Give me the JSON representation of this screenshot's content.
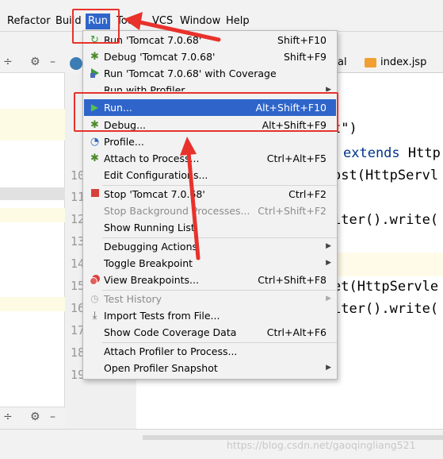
{
  "menubar": {
    "items": [
      "Refactor",
      "Build",
      "Run",
      "Tools",
      "VCS",
      "Window",
      "Help"
    ]
  },
  "editor": {
    "tabs": [
      "al",
      "index.jsp"
    ],
    "line_numbers": [
      "10",
      "11",
      "12",
      "13",
      "14",
      "15",
      "16",
      "17",
      "18",
      "19"
    ],
    "code": {
      "l1_tail": "t\")",
      "l2a": "extends",
      "l2b": " Http",
      "l3": "ost(HttpServl",
      "l4": "iter().write(",
      "l5": "et(HttpServle",
      "l6": "iter().write("
    }
  },
  "run_menu": {
    "items": [
      {
        "label": "Run 'Tomcat 7.0.68'",
        "shortcut": "Shift+F10",
        "icon": "run-config-icon"
      },
      {
        "label": "Debug 'Tomcat 7.0.68'",
        "shortcut": "Shift+F9",
        "icon": "bug-icon"
      },
      {
        "label": "Run 'Tomcat 7.0.68' with Coverage",
        "shortcut": "",
        "icon": "coverage-icon"
      },
      {
        "label": "Run with Profiler",
        "shortcut": "",
        "icon": "",
        "submenu": true
      },
      {
        "label": "Run...",
        "shortcut": "Alt+Shift+F10",
        "icon": "play-icon",
        "selected": true
      },
      {
        "label": "Debug...",
        "shortcut": "Alt+Shift+F9",
        "icon": "bug-icon"
      },
      {
        "label": "Profile...",
        "shortcut": "",
        "icon": "gauge-icon"
      },
      {
        "label": "Attach to Process...",
        "shortcut": "Ctrl+Alt+F5",
        "icon": "attach-icon"
      },
      {
        "label": "Edit Configurations...",
        "shortcut": "",
        "icon": ""
      },
      {
        "label": "Stop 'Tomcat 7.0.68'",
        "shortcut": "Ctrl+F2",
        "icon": "stop-icon"
      },
      {
        "label": "Stop Background Processes...",
        "shortcut": "Ctrl+Shift+F2",
        "icon": "",
        "disabled": true
      },
      {
        "label": "Show Running List",
        "shortcut": "",
        "icon": ""
      },
      {
        "label": "Debugging Actions",
        "shortcut": "",
        "icon": "",
        "submenu": true
      },
      {
        "label": "Toggle Breakpoint",
        "shortcut": "",
        "icon": "",
        "submenu": true
      },
      {
        "label": "View Breakpoints...",
        "shortcut": "Ctrl+Shift+F8",
        "icon": "breakpoints-icon"
      },
      {
        "label": "Test History",
        "shortcut": "",
        "icon": "history-icon",
        "disabled": true,
        "submenu": true
      },
      {
        "label": "Import Tests from File...",
        "shortcut": "",
        "icon": "import-icon"
      },
      {
        "label": "Show Code Coverage Data",
        "shortcut": "Ctrl+Alt+F6",
        "icon": ""
      },
      {
        "label": "Attach Profiler to Process...",
        "shortcut": "",
        "icon": ""
      },
      {
        "label": "Open Profiler Snapshot",
        "shortcut": "",
        "icon": "",
        "submenu": true
      }
    ]
  },
  "colors": {
    "selection": "#2f65ca",
    "annotation_red": "#e8322b"
  },
  "watermark": "https://blog.csdn.net/gaoqingliang521"
}
